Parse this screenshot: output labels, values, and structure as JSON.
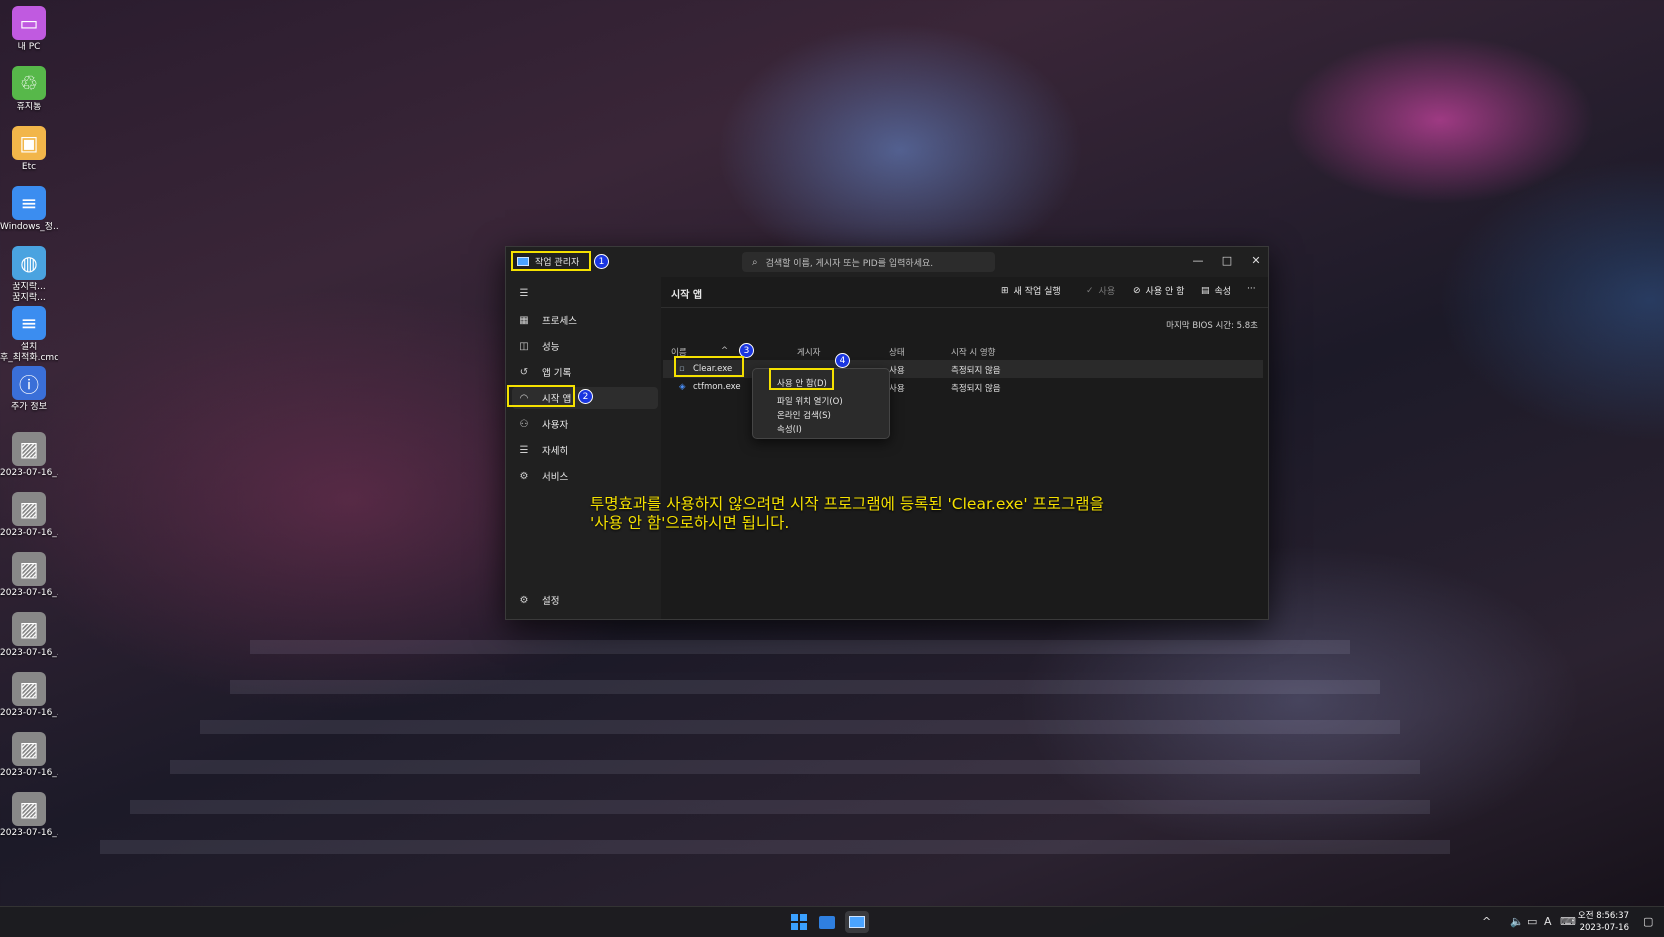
{
  "desktop": {
    "icons": [
      {
        "label": "내 PC",
        "icon": "monitor-icon",
        "color": "#c05ae0"
      },
      {
        "label": "휴지통",
        "icon": "recycle-bin-icon",
        "color": "#57b84a"
      },
      {
        "label": "Etc",
        "icon": "folder-icon",
        "color": "#f2b64a"
      },
      {
        "label": "Windows_정...",
        "icon": "document-icon",
        "color": "#3b8df0"
      },
      {
        "label": "꿈지락...\n꿈지락...",
        "icon": "globe-icon",
        "color": "#4aa3e0"
      },
      {
        "label": "설치\n후_최적화.cmd",
        "icon": "document-icon",
        "color": "#3b8df0"
      },
      {
        "label": "추가 정보",
        "icon": "info-icon",
        "color": "#3a6fd8"
      },
      {
        "label": "2023-07-16_...",
        "icon": "screenshot-icon",
        "color": "#888888"
      },
      {
        "label": "2023-07-16_...",
        "icon": "screenshot-icon",
        "color": "#888888"
      },
      {
        "label": "2023-07-16_...",
        "icon": "screenshot-icon",
        "color": "#888888"
      },
      {
        "label": "2023-07-16_...",
        "icon": "screenshot-icon",
        "color": "#888888"
      },
      {
        "label": "2023-07-16_...",
        "icon": "screenshot-icon",
        "color": "#888888"
      },
      {
        "label": "2023-07-16_...",
        "icon": "screenshot-icon",
        "color": "#888888"
      },
      {
        "label": "2023-07-16_...",
        "icon": "screenshot-icon",
        "color": "#888888"
      }
    ]
  },
  "window": {
    "title": "작업 관리자",
    "search_placeholder": "검색할 이름, 게시자 또는 PID를 입력하세요.",
    "controls": {
      "minimize": "—",
      "maximize": "□",
      "close": "✕"
    }
  },
  "sidebar": {
    "items": [
      {
        "label": "프로세스",
        "icon": "processes-icon"
      },
      {
        "label": "성능",
        "icon": "performance-icon"
      },
      {
        "label": "앱 기록",
        "icon": "app-history-icon"
      },
      {
        "label": "시작 앱",
        "icon": "startup-apps-icon"
      },
      {
        "label": "사용자",
        "icon": "users-icon"
      },
      {
        "label": "자세히",
        "icon": "details-icon"
      },
      {
        "label": "서비스",
        "icon": "services-icon"
      }
    ],
    "settings_label": "설정"
  },
  "content": {
    "page_title": "시작 앱",
    "toolbar": {
      "new_task": "새 작업 실행",
      "enable": "사용",
      "disable": "사용 안 함",
      "properties": "속성",
      "more": "···"
    },
    "bios_time": "마지막 BIOS 시간:  5.8초",
    "columns": {
      "name": "이름",
      "publisher": "게시자",
      "status": "상태",
      "impact": "시작 시 영향"
    },
    "rows": [
      {
        "name": "Clear.exe",
        "publisher": "",
        "status": "사용",
        "impact": "측정되지 않음"
      },
      {
        "name": "ctfmon.exe",
        "publisher": "",
        "status": "사용",
        "impact": "측정되지 않음"
      }
    ]
  },
  "context_menu": {
    "items": [
      "사용 안 함(D)",
      "파일 위치 열기(O)",
      "온라인 검색(S)",
      "속성(I)"
    ]
  },
  "annotations": {
    "badges": [
      "1",
      "2",
      "3",
      "4"
    ],
    "highlight_color": "#f5e100",
    "instruction_line1": "투명효과를 사용하지 않으려면 시작 프로그램에 등록된 'Clear.exe' 프로그램을",
    "instruction_line2": "'사용 안 함'으로하시면 됩니다."
  },
  "taskbar": {
    "apps": [
      "start-icon",
      "file-explorer-icon",
      "task-manager-icon"
    ],
    "tray": {
      "chevron": "^",
      "ime": "A"
    },
    "time": "오전 8:56:37",
    "date": "2023-07-16"
  }
}
